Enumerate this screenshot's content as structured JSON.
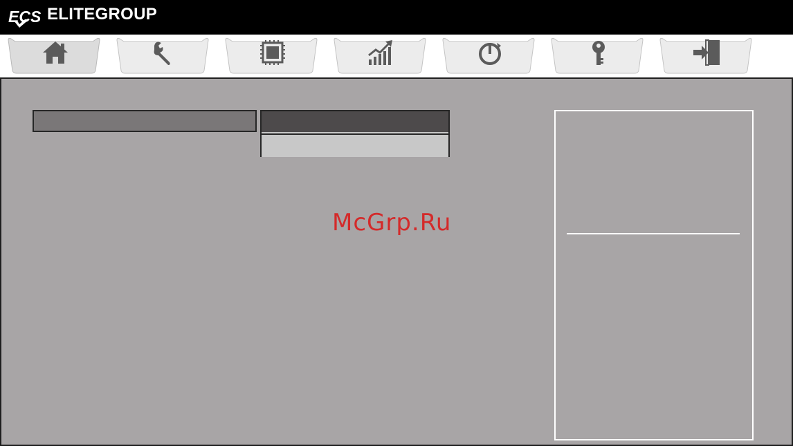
{
  "header": {
    "brand": "ELITEGROUP",
    "logo_text": "ECS",
    "background": "#000000"
  },
  "tabs": [
    {
      "icon": "home-icon"
    },
    {
      "icon": "wrench-icon"
    },
    {
      "icon": "cpu-chip-icon"
    },
    {
      "icon": "chart-up-icon"
    },
    {
      "icon": "power-cycle-icon"
    },
    {
      "icon": "key-icon"
    },
    {
      "icon": "exit-door-icon"
    }
  ],
  "active_tab_index": 0,
  "main": {
    "watermark": "McGrp.Ru",
    "panel_color": "#a8a5a6"
  },
  "colors": {
    "accent_text": "#d42a2a",
    "selected_row": "#4d4a4b",
    "field": "#7a7778"
  }
}
